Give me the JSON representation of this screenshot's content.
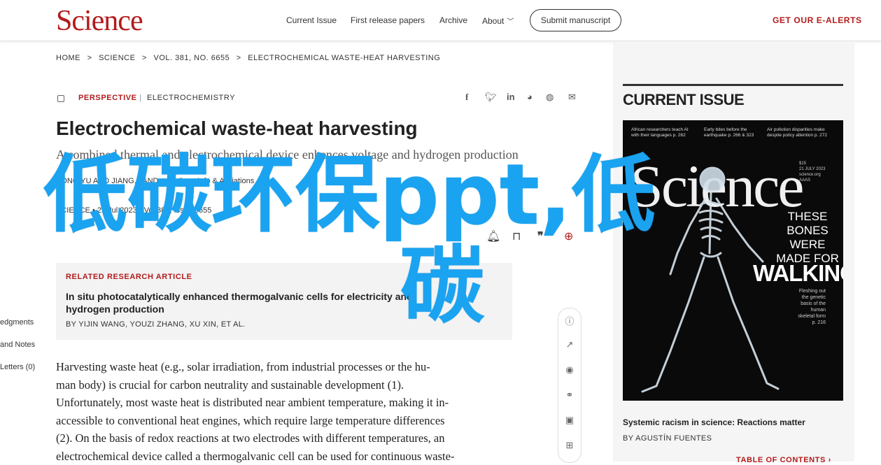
{
  "header": {
    "logo": "Science",
    "nav": [
      "Current Issue",
      "First release papers",
      "Archive",
      "About"
    ],
    "submit": "Submit manuscript",
    "ealerts": "GET OUR E-ALERTS"
  },
  "breadcrumb": [
    "HOME",
    ">",
    "SCIENCE",
    ">",
    "VOL. 381, NO. 6655",
    ">",
    "ELECTROCHEMICAL WASTE-HEAT HARVESTING"
  ],
  "article": {
    "type": "PERSPECTIVE",
    "subject": "ELECTROCHEMISTRY",
    "title": "Electrochemical waste-heat harvesting",
    "subtitle": "A combined thermal and electrochemical device enhances voltage and hydrogen production",
    "authors": "YONG YU AND JIANG... AND ... Authors Info & Affiliations",
    "meta": "SCIENCE  •  21 Jul 2023  •  Vol 381, Issue 6655",
    "body": [
      "Harvesting waste heat (e.g., solar irradiation, from industrial processes or the hu-",
      "man body) is crucial for carbon neutrality and sustainable development (1).",
      "Unfortunately, most waste heat is distributed near ambient temperature, making it in-",
      "accessible to conventional heat engines, which require large temperature differences",
      "(2). On the basis of redox reactions at two electrodes with different temperatures, an",
      "electrochemical device called a thermogalvanic cell can be used for continuous waste-"
    ]
  },
  "related": {
    "label": "RELATED RESEARCH ARTICLE",
    "title": "In situ photocatalytically enhanced thermogalvanic cells for electricity and hydrogen production",
    "authors": "BY YIJIN WANG, YOUZI ZHANG, XU XIN, ET AL."
  },
  "side_left": [
    "edgments",
    "and Notes",
    "Letters (0)"
  ],
  "watermark": {
    "line1": "低碳环保ppt,低",
    "line2": "碳"
  },
  "current_issue": {
    "heading": "CURRENT ISSUE",
    "cover": {
      "brand": "Science",
      "headlines": [
        "African researchers teach AI with their languages p. 262",
        "Early bites before the earthquake p. 266 & 323",
        "Air pollution disparities make despite policy attention p. 272"
      ],
      "side": "$15\n21 JULY 2023\nscience.org\nAAAS",
      "these": "THESE BONES WERE MADE FOR",
      "walking": "WALKING",
      "caption": "Fleshing out the genetic basis of the human skeletal form p. 216"
    },
    "article_title": "Systemic racism in science: Reactions matter",
    "article_author": "BY AGUSTÍN FUENTES",
    "toc": "TABLE OF CONTENTS"
  }
}
